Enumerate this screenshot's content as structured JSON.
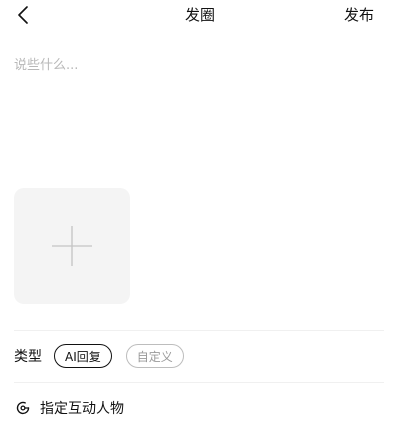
{
  "header": {
    "back_icon": "chevron-left-icon",
    "title": "发圈",
    "publish_label": "发布"
  },
  "composer": {
    "placeholder": "说些什么...",
    "value": ""
  },
  "media": {
    "add_icon": "plus-icon"
  },
  "type_section": {
    "label": "类型",
    "options": [
      {
        "label": "AI回复",
        "selected": true
      },
      {
        "label": "自定义",
        "selected": false
      }
    ]
  },
  "mention": {
    "icon": "mention-circle-icon",
    "label": "指定互动人物"
  },
  "colors": {
    "text": "#111111",
    "placeholder": "#b8b8b8",
    "tile_bg": "#f4f4f4",
    "divider": "#f0f0f0",
    "chip_unselected": "#9a9a9a"
  }
}
